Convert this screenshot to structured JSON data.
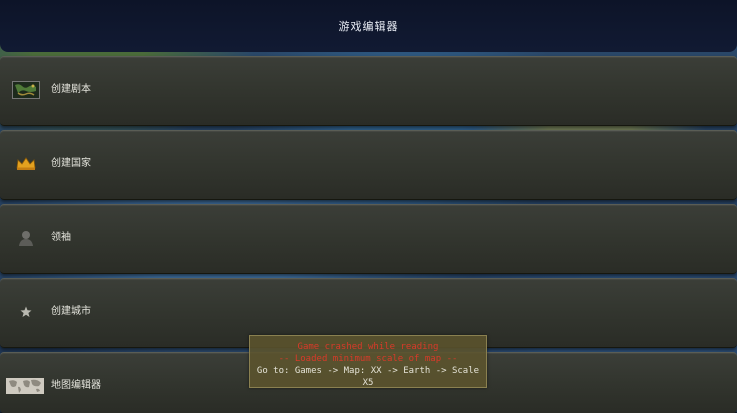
{
  "header": {
    "title": "游戏编辑器"
  },
  "menu": [
    {
      "label": "创建剧本",
      "icon": "map-thumbnail-icon"
    },
    {
      "label": "创建国家",
      "icon": "crown-icon"
    },
    {
      "label": "领袖",
      "icon": "leader-bust-icon"
    },
    {
      "label": "创建城市",
      "icon": "city-star-icon"
    },
    {
      "label": "地图编辑器",
      "icon": "world-map-icon"
    }
  ],
  "toast": {
    "line1": "Game crashed while reading",
    "line2": "-- Loaded minimum scale of map --",
    "line3": "Go to: Games -> Map: XX -> Earth -> Scale X5"
  },
  "colors": {
    "header_bg": "#111a33",
    "row_bg": "#33362f",
    "error_text": "#d83a2a",
    "toast_bg": "#5c542e"
  }
}
